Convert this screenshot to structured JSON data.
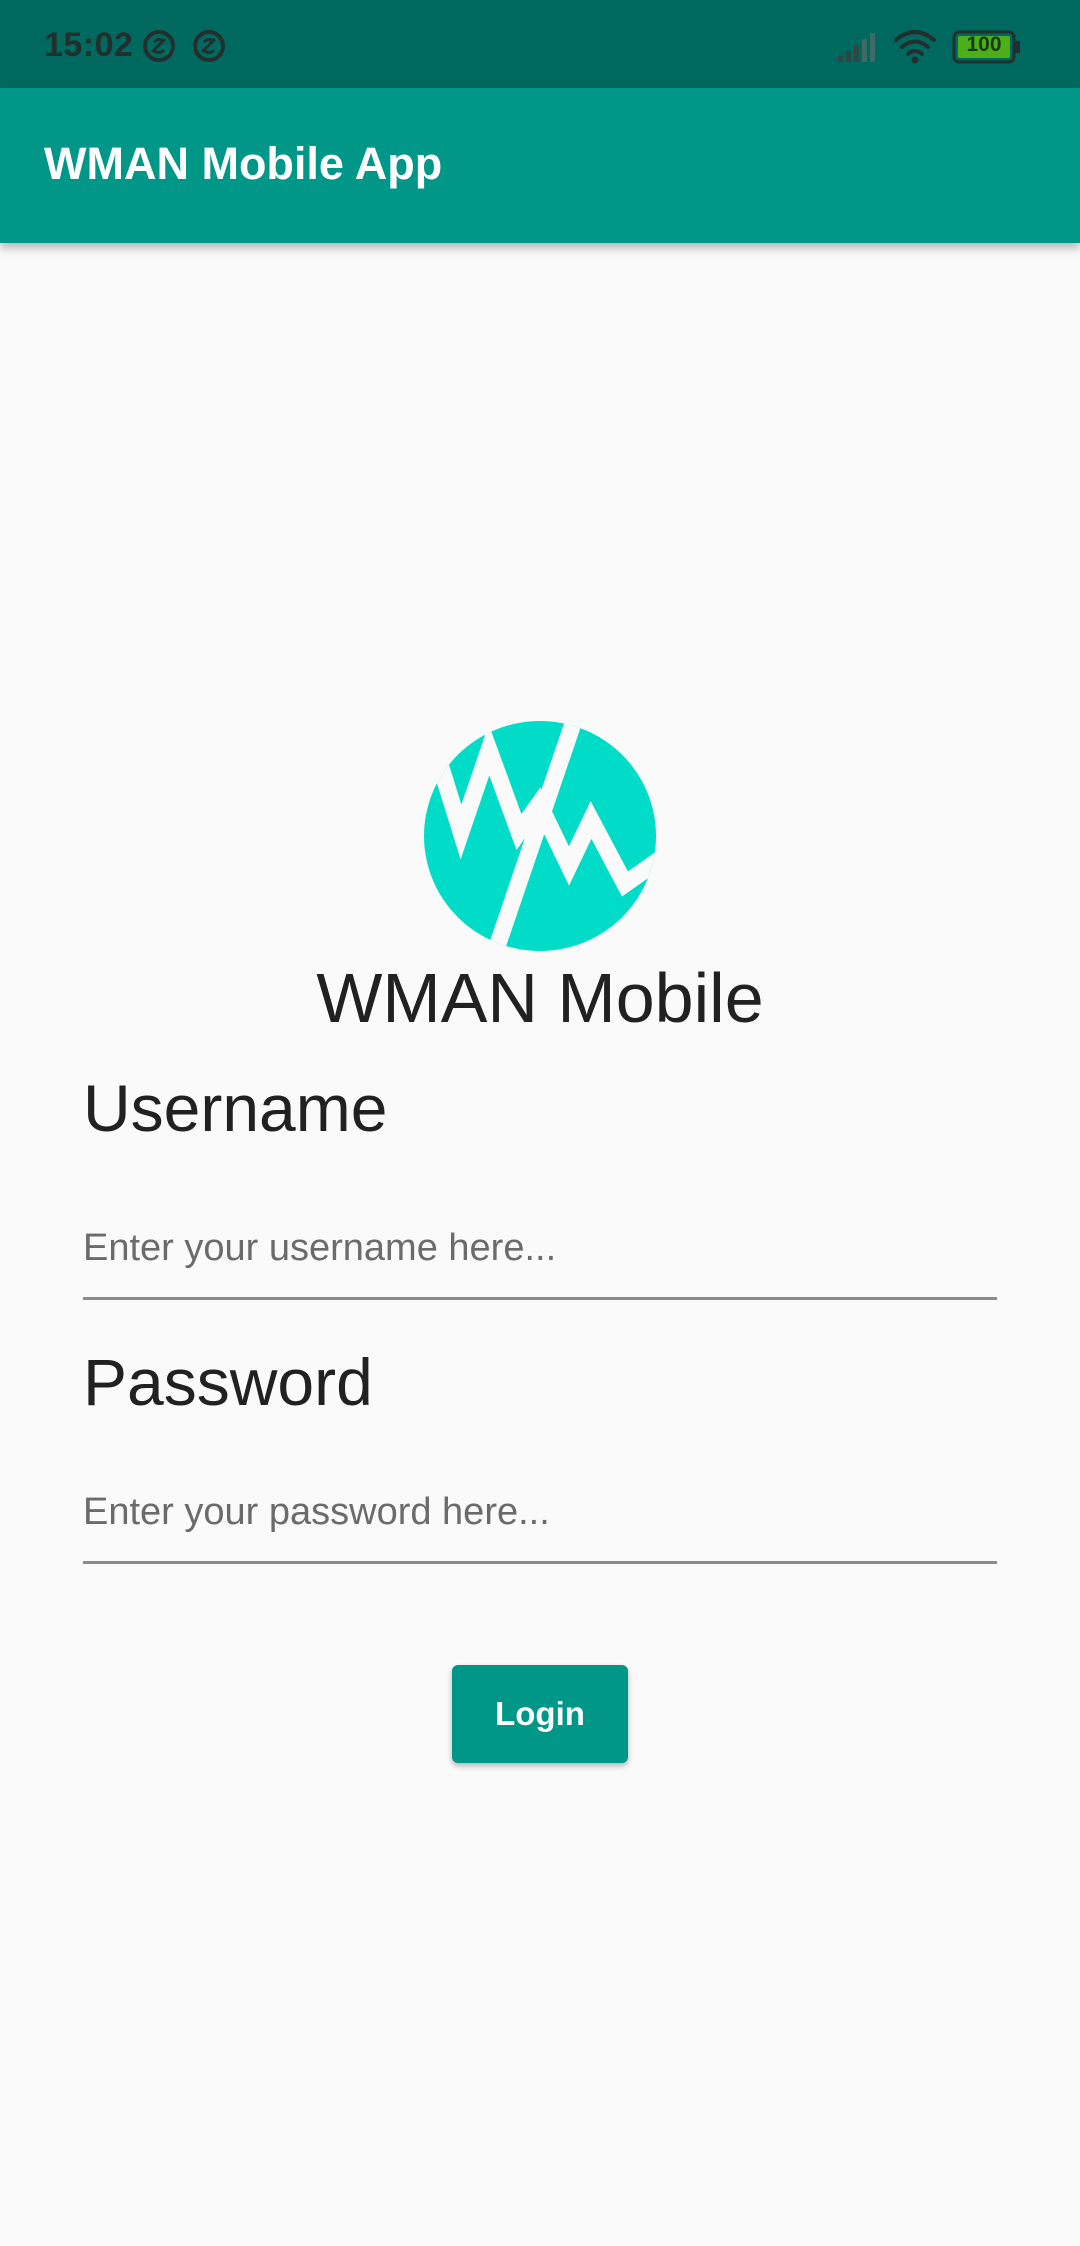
{
  "status_bar": {
    "time": "15:02",
    "battery_level": "100",
    "icons": [
      "notification-icon",
      "notification-icon",
      "signal-icon",
      "wifi-icon",
      "battery-icon"
    ],
    "colors": {
      "background": "#00695f",
      "battery_fill": "#4caf1a"
    }
  },
  "app_bar": {
    "title": "WMAN Mobile App",
    "color": "#009688"
  },
  "brand": {
    "logo_icon": "wman-logo-icon",
    "logo_color": "#00dcc8",
    "name": "WMAN Mobile"
  },
  "form": {
    "username_label": "Username",
    "username_placeholder": "Enter your username here...",
    "username_value": "",
    "password_label": "Password",
    "password_placeholder": "Enter your password here...",
    "password_value": "",
    "login_label": "Login"
  }
}
